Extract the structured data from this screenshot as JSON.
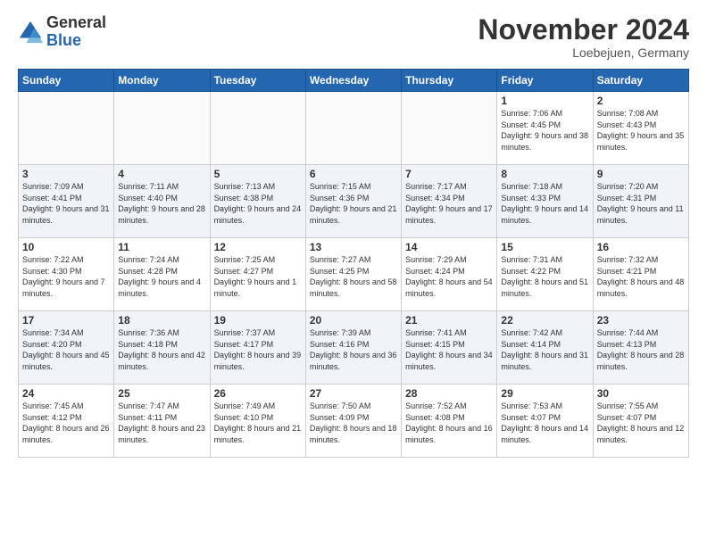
{
  "header": {
    "logo_line1": "General",
    "logo_line2": "Blue",
    "month_title": "November 2024",
    "location": "Loebejuen, Germany"
  },
  "weekdays": [
    "Sunday",
    "Monday",
    "Tuesday",
    "Wednesday",
    "Thursday",
    "Friday",
    "Saturday"
  ],
  "weeks": [
    [
      {
        "day": "",
        "info": ""
      },
      {
        "day": "",
        "info": ""
      },
      {
        "day": "",
        "info": ""
      },
      {
        "day": "",
        "info": ""
      },
      {
        "day": "",
        "info": ""
      },
      {
        "day": "1",
        "info": "Sunrise: 7:06 AM\nSunset: 4:45 PM\nDaylight: 9 hours\nand 38 minutes."
      },
      {
        "day": "2",
        "info": "Sunrise: 7:08 AM\nSunset: 4:43 PM\nDaylight: 9 hours\nand 35 minutes."
      }
    ],
    [
      {
        "day": "3",
        "info": "Sunrise: 7:09 AM\nSunset: 4:41 PM\nDaylight: 9 hours\nand 31 minutes."
      },
      {
        "day": "4",
        "info": "Sunrise: 7:11 AM\nSunset: 4:40 PM\nDaylight: 9 hours\nand 28 minutes."
      },
      {
        "day": "5",
        "info": "Sunrise: 7:13 AM\nSunset: 4:38 PM\nDaylight: 9 hours\nand 24 minutes."
      },
      {
        "day": "6",
        "info": "Sunrise: 7:15 AM\nSunset: 4:36 PM\nDaylight: 9 hours\nand 21 minutes."
      },
      {
        "day": "7",
        "info": "Sunrise: 7:17 AM\nSunset: 4:34 PM\nDaylight: 9 hours\nand 17 minutes."
      },
      {
        "day": "8",
        "info": "Sunrise: 7:18 AM\nSunset: 4:33 PM\nDaylight: 9 hours\nand 14 minutes."
      },
      {
        "day": "9",
        "info": "Sunrise: 7:20 AM\nSunset: 4:31 PM\nDaylight: 9 hours\nand 11 minutes."
      }
    ],
    [
      {
        "day": "10",
        "info": "Sunrise: 7:22 AM\nSunset: 4:30 PM\nDaylight: 9 hours\nand 7 minutes."
      },
      {
        "day": "11",
        "info": "Sunrise: 7:24 AM\nSunset: 4:28 PM\nDaylight: 9 hours\nand 4 minutes."
      },
      {
        "day": "12",
        "info": "Sunrise: 7:25 AM\nSunset: 4:27 PM\nDaylight: 9 hours\nand 1 minute."
      },
      {
        "day": "13",
        "info": "Sunrise: 7:27 AM\nSunset: 4:25 PM\nDaylight: 8 hours\nand 58 minutes."
      },
      {
        "day": "14",
        "info": "Sunrise: 7:29 AM\nSunset: 4:24 PM\nDaylight: 8 hours\nand 54 minutes."
      },
      {
        "day": "15",
        "info": "Sunrise: 7:31 AM\nSunset: 4:22 PM\nDaylight: 8 hours\nand 51 minutes."
      },
      {
        "day": "16",
        "info": "Sunrise: 7:32 AM\nSunset: 4:21 PM\nDaylight: 8 hours\nand 48 minutes."
      }
    ],
    [
      {
        "day": "17",
        "info": "Sunrise: 7:34 AM\nSunset: 4:20 PM\nDaylight: 8 hours\nand 45 minutes."
      },
      {
        "day": "18",
        "info": "Sunrise: 7:36 AM\nSunset: 4:18 PM\nDaylight: 8 hours\nand 42 minutes."
      },
      {
        "day": "19",
        "info": "Sunrise: 7:37 AM\nSunset: 4:17 PM\nDaylight: 8 hours\nand 39 minutes."
      },
      {
        "day": "20",
        "info": "Sunrise: 7:39 AM\nSunset: 4:16 PM\nDaylight: 8 hours\nand 36 minutes."
      },
      {
        "day": "21",
        "info": "Sunrise: 7:41 AM\nSunset: 4:15 PM\nDaylight: 8 hours\nand 34 minutes."
      },
      {
        "day": "22",
        "info": "Sunrise: 7:42 AM\nSunset: 4:14 PM\nDaylight: 8 hours\nand 31 minutes."
      },
      {
        "day": "23",
        "info": "Sunrise: 7:44 AM\nSunset: 4:13 PM\nDaylight: 8 hours\nand 28 minutes."
      }
    ],
    [
      {
        "day": "24",
        "info": "Sunrise: 7:45 AM\nSunset: 4:12 PM\nDaylight: 8 hours\nand 26 minutes."
      },
      {
        "day": "25",
        "info": "Sunrise: 7:47 AM\nSunset: 4:11 PM\nDaylight: 8 hours\nand 23 minutes."
      },
      {
        "day": "26",
        "info": "Sunrise: 7:49 AM\nSunset: 4:10 PM\nDaylight: 8 hours\nand 21 minutes."
      },
      {
        "day": "27",
        "info": "Sunrise: 7:50 AM\nSunset: 4:09 PM\nDaylight: 8 hours\nand 18 minutes."
      },
      {
        "day": "28",
        "info": "Sunrise: 7:52 AM\nSunset: 4:08 PM\nDaylight: 8 hours\nand 16 minutes."
      },
      {
        "day": "29",
        "info": "Sunrise: 7:53 AM\nSunset: 4:07 PM\nDaylight: 8 hours\nand 14 minutes."
      },
      {
        "day": "30",
        "info": "Sunrise: 7:55 AM\nSunset: 4:07 PM\nDaylight: 8 hours\nand 12 minutes."
      }
    ]
  ]
}
